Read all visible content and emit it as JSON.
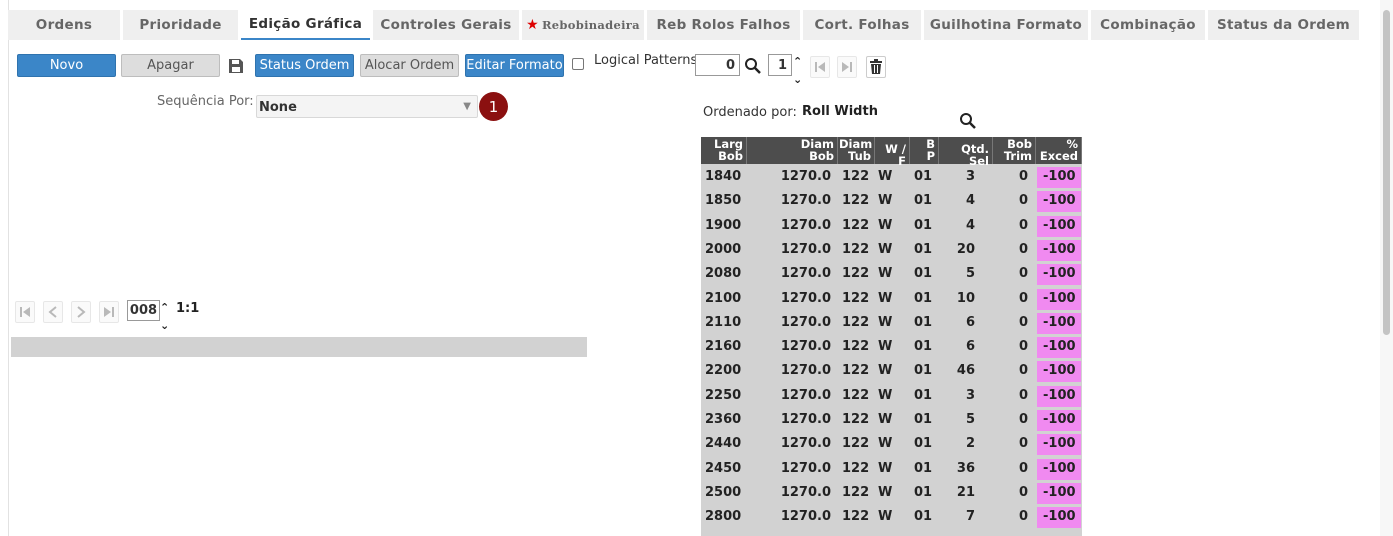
{
  "tabs": [
    {
      "label": "Ordens"
    },
    {
      "label": "Prioridade"
    },
    {
      "label": "Edição Gráfica"
    },
    {
      "label": "Controles Gerais"
    },
    {
      "label": "Rebobinadeira"
    },
    {
      "label": "Reb Rolos Falhos"
    },
    {
      "label": "Cort. Folhas"
    },
    {
      "label": "Guilhotina Formato"
    },
    {
      "label": "Combinação"
    },
    {
      "label": "Status da Ordem"
    }
  ],
  "toolbar": {
    "novo": "Novo",
    "apagar": "Apagar",
    "status_ordem": "Status Ordem",
    "alocar_ordem": "Alocar Ordem",
    "editar_formato": "Editar Formato",
    "logical_patterns": "Logical Patterns",
    "patterns_value": "0",
    "page_value": "1"
  },
  "sequence": {
    "label": "Sequência Por:",
    "value": "None",
    "badge": "1"
  },
  "pager": {
    "value": "008",
    "ratio": "1:1"
  },
  "sort": {
    "label": "Ordenado por:",
    "value": "Roll Width"
  },
  "table": {
    "headers": [
      {
        "l1": "Larg",
        "l2": "Bob"
      },
      {
        "l1": "Diam",
        "l2": "Bob"
      },
      {
        "l1": "Diam",
        "l2": "Tub"
      },
      {
        "l1": "W / F",
        "l2": ""
      },
      {
        "l1": "B",
        "l2": "P"
      },
      {
        "l1": "Qtd. Sel",
        "l2": ""
      },
      {
        "l1": "Bob",
        "l2": "Trim"
      },
      {
        "l1": "%",
        "l2": "Exced"
      }
    ],
    "rows": [
      [
        "1840",
        "1270.0",
        "122",
        "W",
        "01",
        "3",
        "0",
        "-100"
      ],
      [
        "1850",
        "1270.0",
        "122",
        "W",
        "01",
        "4",
        "0",
        "-100"
      ],
      [
        "1900",
        "1270.0",
        "122",
        "W",
        "01",
        "4",
        "0",
        "-100"
      ],
      [
        "2000",
        "1270.0",
        "122",
        "W",
        "01",
        "20",
        "0",
        "-100"
      ],
      [
        "2080",
        "1270.0",
        "122",
        "W",
        "01",
        "5",
        "0",
        "-100"
      ],
      [
        "2100",
        "1270.0",
        "122",
        "W",
        "01",
        "10",
        "0",
        "-100"
      ],
      [
        "2110",
        "1270.0",
        "122",
        "W",
        "01",
        "6",
        "0",
        "-100"
      ],
      [
        "2160",
        "1270.0",
        "122",
        "W",
        "01",
        "6",
        "0",
        "-100"
      ],
      [
        "2200",
        "1270.0",
        "122",
        "W",
        "01",
        "46",
        "0",
        "-100"
      ],
      [
        "2250",
        "1270.0",
        "122",
        "W",
        "01",
        "3",
        "0",
        "-100"
      ],
      [
        "2360",
        "1270.0",
        "122",
        "W",
        "01",
        "5",
        "0",
        "-100"
      ],
      [
        "2440",
        "1270.0",
        "122",
        "W",
        "01",
        "2",
        "0",
        "-100"
      ],
      [
        "2450",
        "1270.0",
        "122",
        "W",
        "01",
        "36",
        "0",
        "-100"
      ],
      [
        "2500",
        "1270.0",
        "122",
        "W",
        "01",
        "21",
        "0",
        "-100"
      ],
      [
        "2800",
        "1270.0",
        "122",
        "W",
        "01",
        "7",
        "0",
        "-100"
      ]
    ]
  },
  "colors": {
    "accent": "#3b86c8",
    "exced": "#f08af0",
    "badge": "#8b1010",
    "header": "#4d4d4d"
  }
}
